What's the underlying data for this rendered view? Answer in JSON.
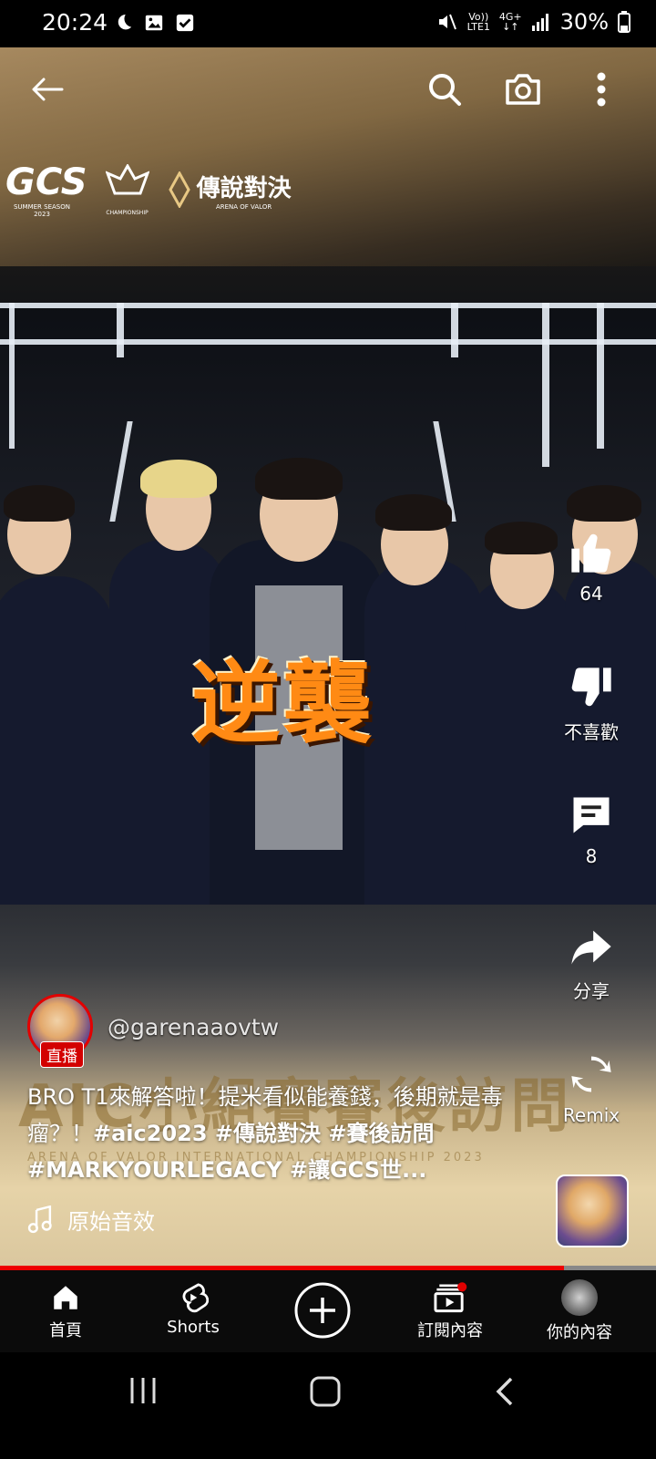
{
  "status_bar": {
    "time": "20:24",
    "network_top": "Vo))",
    "network_bottom": "LTE1",
    "data_type": "4G+",
    "battery": "30%"
  },
  "top_actions": {
    "back": "arrow-left-icon",
    "search": "search-icon",
    "camera": "camera-icon",
    "more": "more-vertical-icon"
  },
  "video": {
    "overlay_text": "逆襲",
    "logo_gcs": "GCS",
    "logo_gcs_sub": "SUMMER SEASON 2023",
    "logo_aov": "傳說對決",
    "logo_aov_sub": "ARENA OF VALOR",
    "logo_champ": "CHAMPIONSHIP",
    "bottom_banner": "AIC小組賽賽後訪問",
    "bottom_banner_sub": "ARENA OF VALOR INTERNATIONAL CHAMPIONSHIP 2023"
  },
  "actions": {
    "like_count": "64",
    "dislike_label": "不喜歡",
    "comment_count": "8",
    "share_label": "分享",
    "remix_label": "Remix"
  },
  "channel": {
    "live_badge": "直播",
    "handle": "@garenaaovtw"
  },
  "caption": {
    "text": "BRO T1來解答啦！提米看似能養錢，後期就是毒瘤？！",
    "hashtags": "#aic2023 #傳說對決 #賽後訪問 #MARKYOURLEGACY #讓GCS世..."
  },
  "audio": {
    "label": "原始音效"
  },
  "progress": {
    "fraction": 0.86
  },
  "bottom_nav": {
    "items": [
      {
        "label": "首頁",
        "icon": "home-icon"
      },
      {
        "label": "Shorts",
        "icon": "shorts-icon"
      },
      {
        "label": "",
        "icon": "create-plus-icon"
      },
      {
        "label": "訂閱內容",
        "icon": "subscriptions-icon"
      },
      {
        "label": "你的內容",
        "icon": "avatar-icon"
      }
    ]
  },
  "colors": {
    "accent_red": "#e00000",
    "overlay_orange": "#ff8a14"
  }
}
